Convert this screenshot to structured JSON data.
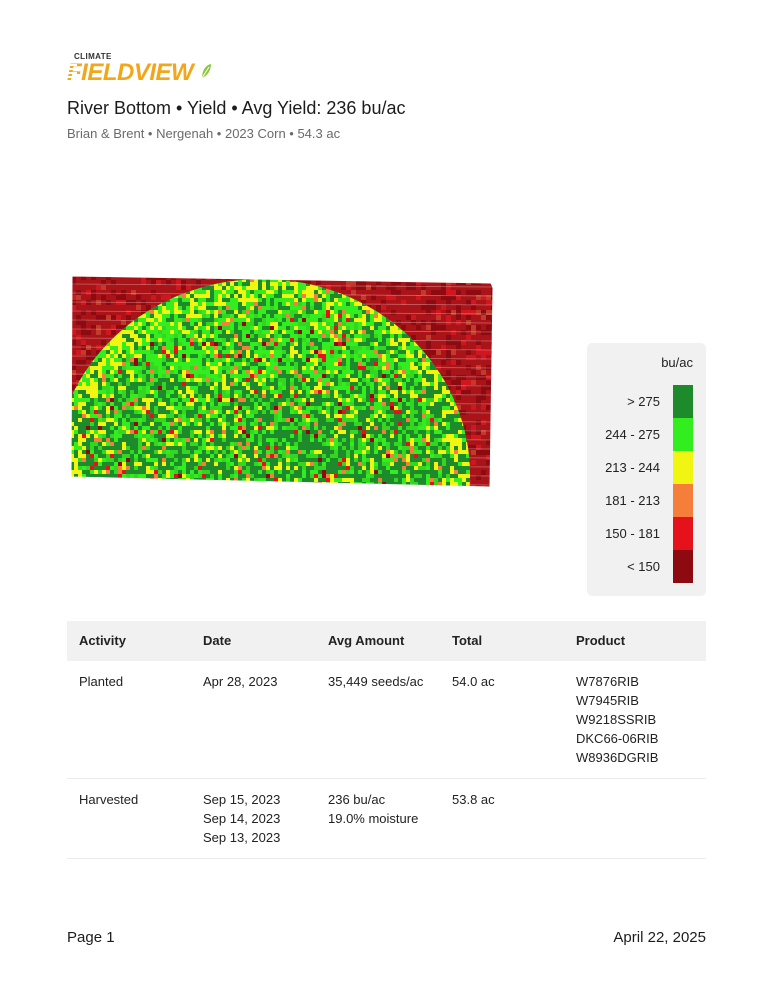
{
  "brand": {
    "top": "CLIMATE",
    "name": "FIELDVIEW",
    "colors": {
      "brand": "#f2a71b",
      "leaf": "#8cc63f"
    },
    "icon": "leaf-icon"
  },
  "report": {
    "title": "River Bottom • Yield • Avg Yield: 236 bu/ac",
    "subtitle": "Brian & Brent • Nergenah • 2023 Corn • 54.3 ac"
  },
  "legend": {
    "unit": "bu/ac",
    "items": [
      {
        "label": "> 275",
        "color": "#1d8a2b"
      },
      {
        "label": "244 - 275",
        "color": "#33ee1e"
      },
      {
        "label": "213 - 244",
        "color": "#f0f511"
      },
      {
        "label": "181 - 213",
        "color": "#f57f3a"
      },
      {
        "label": "150 - 181",
        "color": "#e5121b"
      },
      {
        "label": "< 150",
        "color": "#8c0a10"
      }
    ]
  },
  "table": {
    "headers": [
      "Activity",
      "Date",
      "Avg Amount",
      "Total",
      "Product"
    ],
    "rows": [
      {
        "activity": "Planted",
        "dates": [
          "Apr 28, 2023"
        ],
        "amounts": [
          "35,449 seeds/ac"
        ],
        "total": "54.0 ac",
        "products": [
          "W7876RIB",
          "W7945RIB",
          "W9218SSRIB",
          "DKC66-06RIB",
          "W8936DGRIB"
        ]
      },
      {
        "activity": "Harvested",
        "dates": [
          "Sep 15, 2023",
          "Sep 14, 2023",
          "Sep 13, 2023"
        ],
        "amounts": [
          "236 bu/ac",
          "19.0% moisture"
        ],
        "total": "53.8 ac",
        "products": []
      }
    ]
  },
  "footer": {
    "page": "Page 1",
    "date": "April 22, 2025"
  }
}
